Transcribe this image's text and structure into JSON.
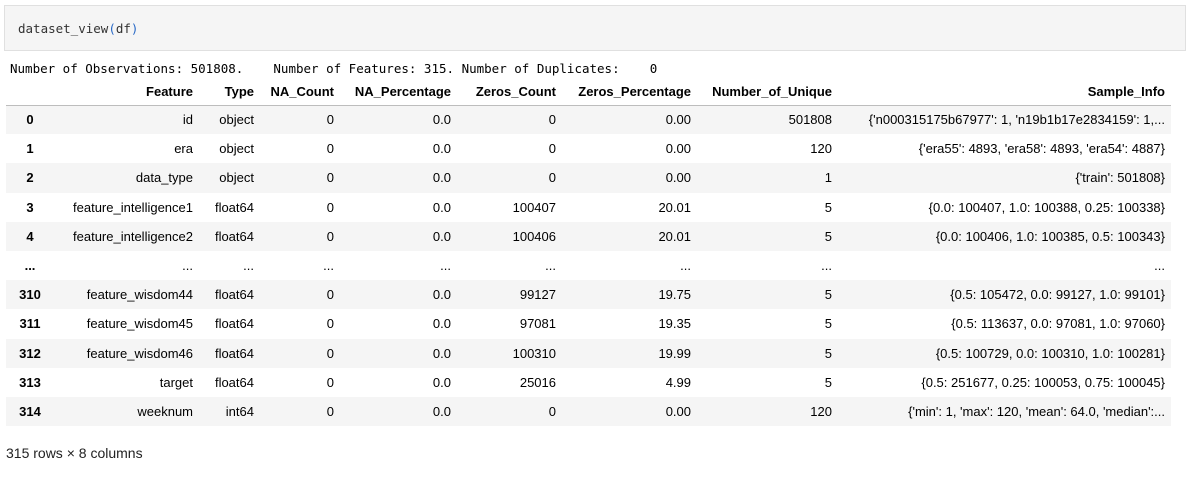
{
  "code_cell": {
    "function_name": "dataset_view",
    "open_paren": "(",
    "argument": "df",
    "close_paren": ")"
  },
  "stdout": {
    "observations": "Number of Observations: 501808.",
    "features": "Number of Features: 315.",
    "duplicates_label": "Number of Duplicates:",
    "duplicates_value": "0"
  },
  "table": {
    "columns": [
      "",
      "Feature",
      "Type",
      "NA_Count",
      "NA_Percentage",
      "Zeros_Count",
      "Zeros_Percentage",
      "Number_of_Unique",
      "Sample_Info"
    ],
    "rows": [
      [
        "0",
        "id",
        "object",
        "0",
        "0.0",
        "0",
        "0.00",
        "501808",
        "{'n000315175b67977': 1, 'n19b1b17e2834159': 1,..."
      ],
      [
        "1",
        "era",
        "object",
        "0",
        "0.0",
        "0",
        "0.00",
        "120",
        "{'era55': 4893, 'era58': 4893, 'era54': 4887}"
      ],
      [
        "2",
        "data_type",
        "object",
        "0",
        "0.0",
        "0",
        "0.00",
        "1",
        "{'train': 501808}"
      ],
      [
        "3",
        "feature_intelligence1",
        "float64",
        "0",
        "0.0",
        "100407",
        "20.01",
        "5",
        "{0.0: 100407, 1.0: 100388, 0.25: 100338}"
      ],
      [
        "4",
        "feature_intelligence2",
        "float64",
        "0",
        "0.0",
        "100406",
        "20.01",
        "5",
        "{0.0: 100406, 1.0: 100385, 0.5: 100343}"
      ],
      [
        "...",
        "...",
        "...",
        "...",
        "...",
        "...",
        "...",
        "...",
        "..."
      ],
      [
        "310",
        "feature_wisdom44",
        "float64",
        "0",
        "0.0",
        "99127",
        "19.75",
        "5",
        "{0.5: 105472, 0.0: 99127, 1.0: 99101}"
      ],
      [
        "311",
        "feature_wisdom45",
        "float64",
        "0",
        "0.0",
        "97081",
        "19.35",
        "5",
        "{0.5: 113637, 0.0: 97081, 1.0: 97060}"
      ],
      [
        "312",
        "feature_wisdom46",
        "float64",
        "0",
        "0.0",
        "100310",
        "19.99",
        "5",
        "{0.5: 100729, 0.0: 100310, 1.0: 100281}"
      ],
      [
        "313",
        "target",
        "float64",
        "0",
        "0.0",
        "25016",
        "4.99",
        "5",
        "{0.5: 251677, 0.25: 100053, 0.75: 100045}"
      ],
      [
        "314",
        "weeknum",
        "int64",
        "0",
        "0.0",
        "0",
        "0.00",
        "120",
        "{'min': 1, 'max': 120, 'mean': 64.0, 'median':..."
      ]
    ]
  },
  "footer": {
    "shape_text": "315 rows × 8 columns"
  },
  "colors": {
    "code_cell_bg": "#f5f5f5",
    "paren_color": "#2a6ac7",
    "stripe_bg": "#f5f5f5"
  }
}
